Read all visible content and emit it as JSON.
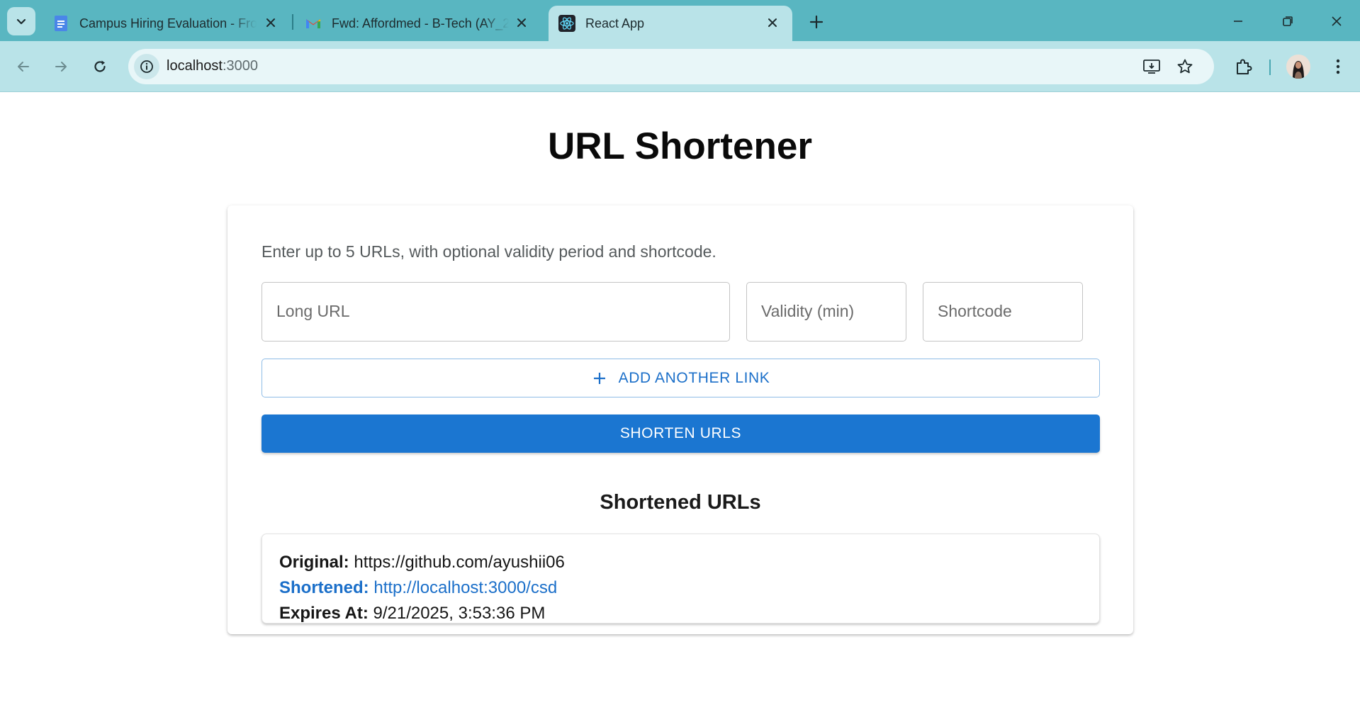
{
  "browser": {
    "tabs": [
      {
        "title": "Campus Hiring Evaluation - Fro",
        "icon": "google-docs-icon",
        "active": false
      },
      {
        "title": "Fwd: Affordmed - B-Tech (AY_2(",
        "icon": "gmail-icon",
        "active": false
      },
      {
        "title": "React App",
        "icon": "react-icon",
        "active": true
      }
    ],
    "address": {
      "host": "localhost",
      "port": ":3000"
    },
    "colors": {
      "tabstrip": "#59b6c1",
      "toolbar": "#b9e3e8",
      "omnibox": "#e8f6f8"
    }
  },
  "page": {
    "title": "URL Shortener",
    "instructions": "Enter up to 5 URLs, with optional validity period and shortcode.",
    "fields": {
      "long_url": {
        "placeholder": "Long URL",
        "value": ""
      },
      "validity": {
        "placeholder": "Validity (min)",
        "value": ""
      },
      "shortcode": {
        "placeholder": "Shortcode",
        "value": ""
      }
    },
    "add_button": "ADD ANOTHER LINK",
    "shorten_button": "SHORTEN URLS",
    "results_heading": "Shortened URLs",
    "results": [
      {
        "original_label": "Original:",
        "original": "https://github.com/ayushii06",
        "shortened_label": "Shortened:",
        "shortened": "http://localhost:3000/csd",
        "expires_label": "Expires At:",
        "expires": "9/21/2025, 3:53:36 PM"
      }
    ],
    "colors": {
      "primary": "#1b76d1",
      "link": "#1b6fc9"
    }
  }
}
